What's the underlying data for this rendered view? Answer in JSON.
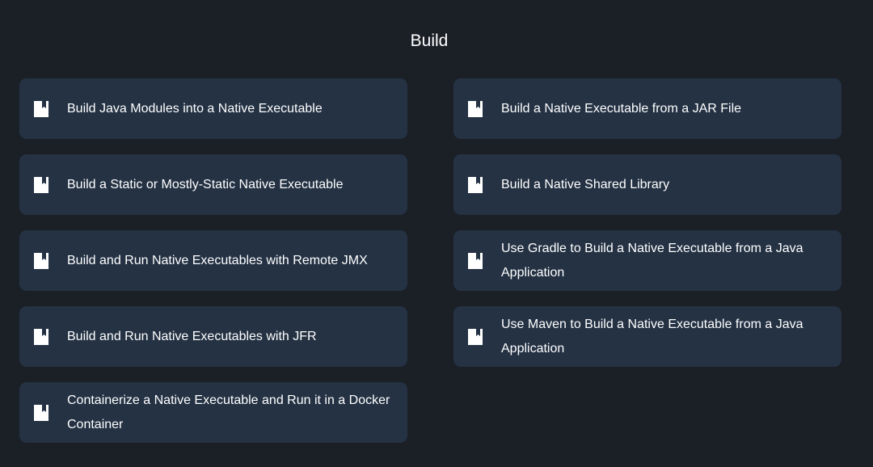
{
  "page": {
    "title": "Build"
  },
  "colors": {
    "background": "#1b1f26",
    "card": "#243244",
    "text": "#ffffff"
  },
  "cards": [
    {
      "label": "Build Java Modules into a Native Executable",
      "icon": "book-icon"
    },
    {
      "label": "Build a Native Executable from a JAR File",
      "icon": "book-icon"
    },
    {
      "label": "Build a Static or Mostly-Static Native Executable",
      "icon": "book-icon"
    },
    {
      "label": "Build a Native Shared Library",
      "icon": "book-icon"
    },
    {
      "label": "Build and Run Native Executables with Remote JMX",
      "icon": "book-icon"
    },
    {
      "label": "Use Gradle to Build a Native Executable from a Java Application",
      "icon": "book-icon"
    },
    {
      "label": "Build and Run Native Executables with JFR",
      "icon": "book-icon"
    },
    {
      "label": "Use Maven to Build a Native Executable from a Java Application",
      "icon": "book-icon"
    },
    {
      "label": "Containerize a Native Executable and Run it in a Docker Container",
      "icon": "book-icon"
    }
  ]
}
